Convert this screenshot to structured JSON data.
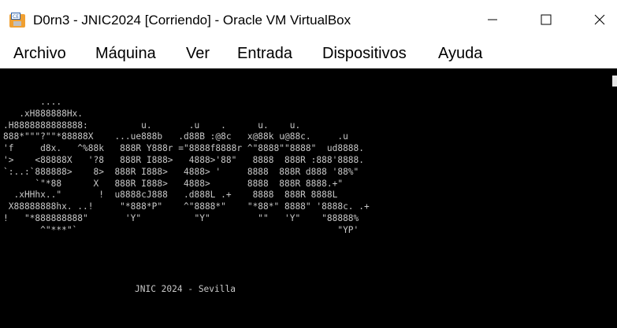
{
  "window": {
    "title": "D0rn3 - JNIC2024 [Corriendo] - Oracle VM VirtualBox"
  },
  "menu": {
    "items": [
      "Archivo",
      "Máquina",
      "Ver",
      "Entrada",
      "Dispositivos",
      "Ayuda"
    ]
  },
  "console": {
    "ascii_art": "       ....\n   .xH888888Hx.\n.H8888888888888:          u.       .u    .      u.    u.\n888*\"\"\"?\"\"*88888X    ...ue888b   .d88B :@8c   x@88k u@88c.     .u\n'f     d8x.   ^%88k   888R Y888r =\"8888f8888r ^\"8888\"\"8888\"  ud8888.\n'>    <88888X   '?8   888R I888>   4888>'88\"   8888  888R :888'8888.\n`:..:`888888>    8>  888R I888>   4888> '     8888  888R d888 '88%\"\n      `\"*88      X   888R I888>   4888>       8888  888R 8888.+\"\n  .xHHhx..\"       !  u8888cJ888   .d888L .+    8888  888R 8888L\n X88888888hx. ..!     \"*888*P\"    ^\"8888*\"    \"*88*\" 8888\" '8888c. .+\n!   \"*888888888\"       'Y\"          \"Y\"         \"\"   'Y\"    \"88888%\n       ^\"***\"`                                                 \"YP'",
    "footer": "JNIC 2024 - Sevilla"
  },
  "colors": {
    "screen_bg": "#000000",
    "console_text": "#c8c8c8",
    "chrome_bg": "#ffffff"
  }
}
